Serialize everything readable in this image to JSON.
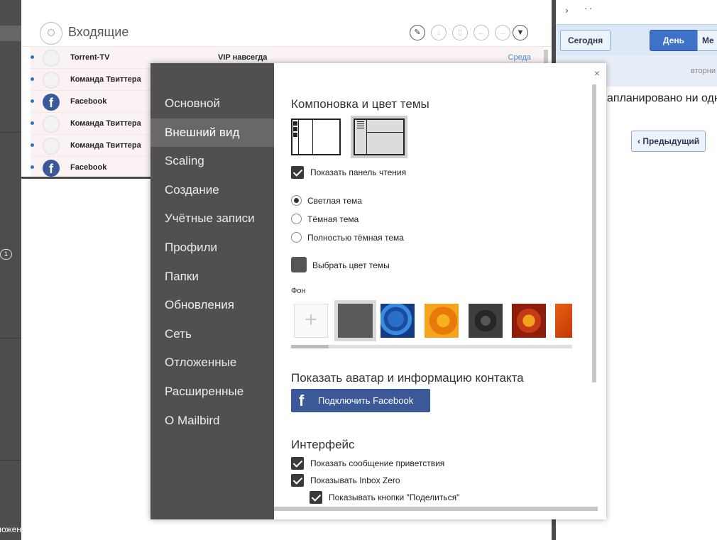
{
  "rail": {
    "badge": "1",
    "bottom_text": "Отложен"
  },
  "mail": {
    "title": "Входящие",
    "toolbar_icons": [
      "compose-icon",
      "download-icon",
      "trash-icon",
      "reply-icon",
      "forward-icon",
      "more-icon"
    ],
    "rows": [
      {
        "sender": "Torrent-TV",
        "subject": "VIP навсегда",
        "date": "Среда",
        "avatar": "contact"
      },
      {
        "sender": "Команда Твиттера",
        "subject": "",
        "date": "",
        "avatar": "contact"
      },
      {
        "sender": "Facebook",
        "subject": "",
        "date": "",
        "avatar": "facebook"
      },
      {
        "sender": "Команда Твиттера",
        "subject": "",
        "date": "",
        "avatar": "contact"
      },
      {
        "sender": "Команда Твиттера",
        "subject": "",
        "date": "",
        "avatar": "contact"
      },
      {
        "sender": "Facebook",
        "subject": "",
        "date": "",
        "avatar": "facebook"
      }
    ]
  },
  "calendar": {
    "nav_back": "›",
    "nav_dots": "··",
    "today": "Сегодня",
    "day": "День",
    "month": "Ме",
    "date_header": "вторни",
    "empty_text": "апланировано ни одн",
    "prev": "‹ Предыдущий"
  },
  "dialog": {
    "close": "×",
    "nav": [
      "Основной",
      "Внешний вид",
      "Scaling",
      "Создание",
      "Учётные записи",
      "Профили",
      "Папки",
      "Обновления",
      "Сеть",
      "Отложенные",
      "Расширенные",
      "О Mailbird"
    ],
    "active_nav_index": 1,
    "layout_heading": "Компоновка и цвет темы",
    "show_reading_pane": "Показать панель чтения",
    "themes": [
      "Светлая тема",
      "Тёмная тема",
      "Полностью тёмная тема"
    ],
    "selected_theme_index": 0,
    "pick_color": "Выбрать цвет темы",
    "theme_color": "#555555",
    "bg_label": "Фон",
    "bg_add": "+",
    "avatar_heading": "Показать аватар и информацию контакта",
    "fb_icon": "f",
    "fb_button": "Подключить Facebook",
    "interface_heading": "Интерфейс",
    "interface_options": [
      "Показать сообщение приветствия",
      "Показывать Inbox Zero",
      "Показывать кнопки \"Поделиться\""
    ]
  }
}
